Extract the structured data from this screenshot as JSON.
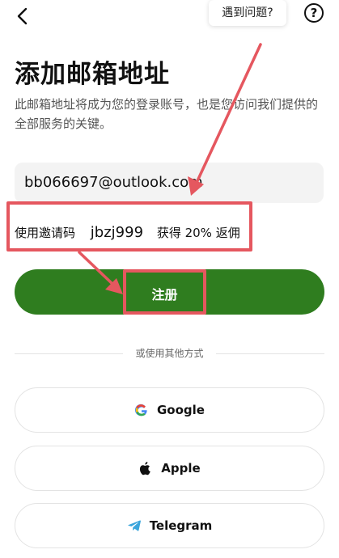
{
  "header": {
    "back_icon": "chevron-left-icon",
    "help_text": "遇到问题?",
    "help_icon_glyph": "?"
  },
  "title": "添加邮箱地址",
  "description": "此邮箱地址将成为您的登录账号，也是您访问我们提供的全部服务的关键。",
  "email_value": "bb066697@outlook.com",
  "invite": {
    "label": "使用邀请码",
    "code": "jbzj999",
    "reward": "获得 20% 返佣"
  },
  "register_label": "注册",
  "divider_text": "或使用其他方式",
  "social": [
    {
      "label": "Google",
      "icon": "google-icon"
    },
    {
      "label": "Apple",
      "icon": "apple-icon"
    },
    {
      "label": "Telegram",
      "icon": "telegram-icon"
    }
  ],
  "colors": {
    "primary": "#2f7d1f",
    "annotation": "#e5575f"
  }
}
